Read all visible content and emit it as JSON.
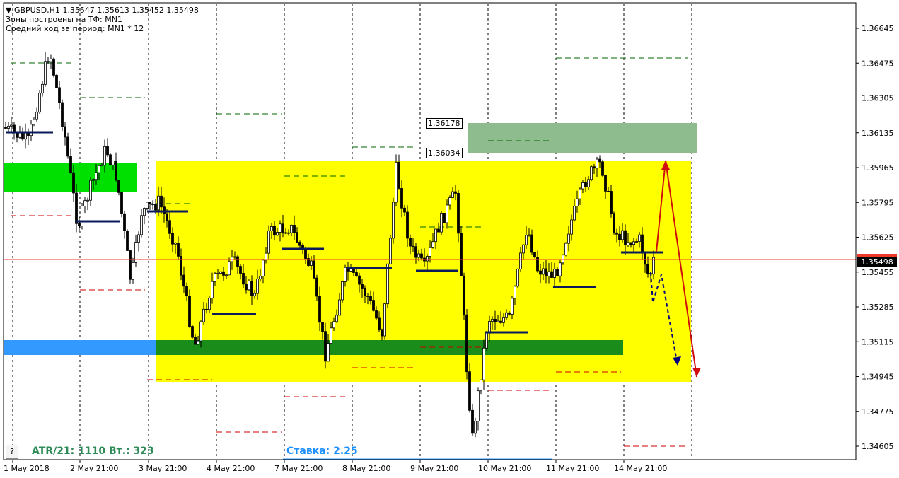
{
  "header": {
    "symbol_line": "GBPUSD,H1  1.35547 1.35613 1.35452 1.35498",
    "line2": "Зоны построены на ТФ: MN1",
    "line3": "Средний ход за период: MN1 * 12"
  },
  "price_axis": {
    "labels": [
      "1.36645",
      "1.36475",
      "1.36305",
      "1.36135",
      "1.35965",
      "1.35795",
      "1.35625",
      "1.35455",
      "1.35285",
      "1.35115",
      "1.34945",
      "1.34775",
      "1.34605"
    ],
    "current_price": "1.35498"
  },
  "time_axis": {
    "labels": [
      "1 May 2018",
      "2 May 21:00",
      "3 May 21:00",
      "4 May 21:00",
      "7 May 21:00",
      "8 May 21:00",
      "9 May 21:00",
      "10 May 21:00",
      "11 May 21:00",
      "14 May 21:00"
    ]
  },
  "level_labels": {
    "upper": "1.36178",
    "lower": "1.36034"
  },
  "bottom": {
    "help_button": "?",
    "atr_text": "ATR/21: 1110  Вт.: 323",
    "rate_text": "Ставка: 2.25"
  },
  "colors": {
    "yellow_zone": "#ffff00",
    "green_zone": "#1a8c1a",
    "light_green_zone": "#00e000",
    "blue_zone": "#3399ff",
    "gray_green_zone": "#8fbc8f",
    "up_arrow": "#d01010",
    "blue_arrow": "#000080",
    "current_price_line": "#ee3a2a"
  }
}
